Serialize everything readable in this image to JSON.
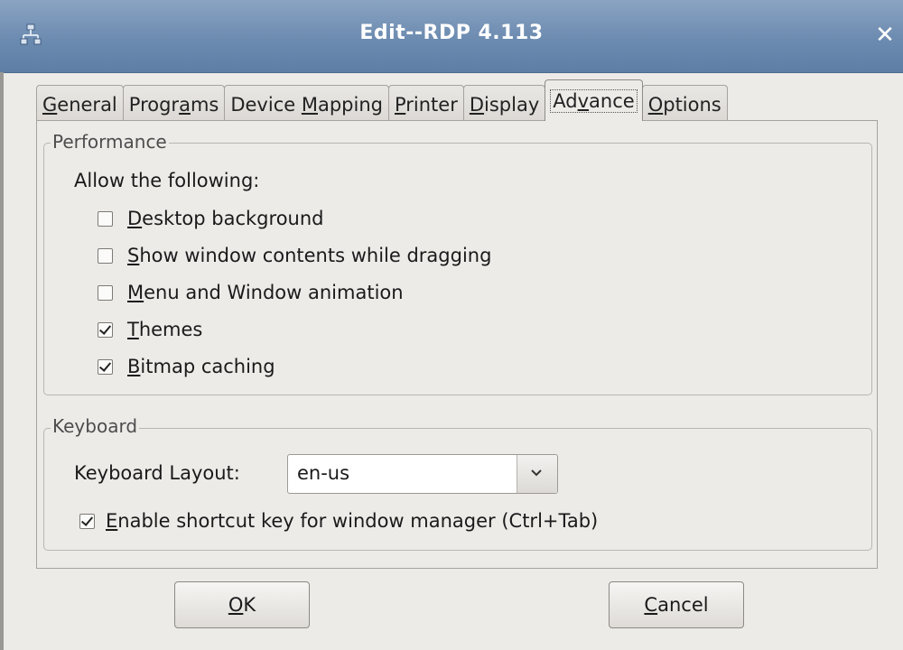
{
  "window": {
    "title": "Edit--RDP 4.113",
    "app_icon": "network-icon",
    "close_glyph": "✕"
  },
  "tabs": [
    {
      "pre": "",
      "ul": "G",
      "post": "eneral",
      "active": false
    },
    {
      "pre": "Progr",
      "ul": "a",
      "post": "ms",
      "active": false
    },
    {
      "pre": "Device ",
      "ul": "M",
      "post": "apping",
      "active": false
    },
    {
      "pre": "",
      "ul": "P",
      "post": "rinter",
      "active": false
    },
    {
      "pre": "",
      "ul": "D",
      "post": "isplay",
      "active": false
    },
    {
      "pre": "Ad",
      "ul": "v",
      "post": "ance",
      "active": true
    },
    {
      "pre": "",
      "ul": "O",
      "post": "ptions",
      "active": false
    }
  ],
  "performance": {
    "frame_label": "Performance",
    "allow_label": "Allow the following:",
    "options": [
      {
        "ul": "D",
        "post": "esktop background",
        "checked": false
      },
      {
        "ul": "S",
        "post": "how window contents while dragging",
        "checked": false
      },
      {
        "ul": "M",
        "post": "enu and Window animation",
        "checked": false
      },
      {
        "ul": "T",
        "post": "hemes",
        "checked": true
      },
      {
        "ul": "B",
        "post": "itmap caching",
        "checked": true
      }
    ]
  },
  "keyboard": {
    "frame_label": "Keyboard",
    "layout_label": "Keyboard Layout:",
    "layout_value": "en-us",
    "shortcut": {
      "ul": "E",
      "post": "nable shortcut key for window manager (Ctrl+Tab)",
      "checked": true
    }
  },
  "buttons": {
    "ok": {
      "ul": "O",
      "post": "K"
    },
    "cancel": {
      "ul": "C",
      "post": "ancel"
    }
  }
}
